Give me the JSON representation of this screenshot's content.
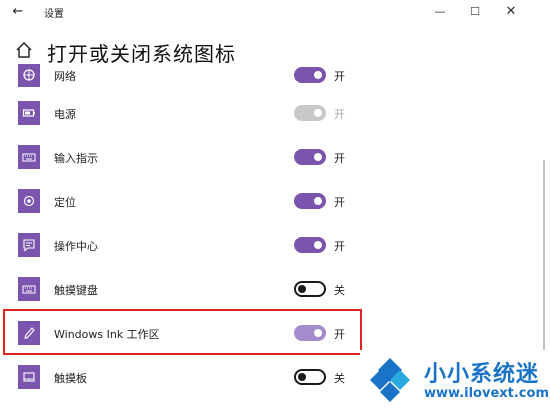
{
  "window": {
    "back_glyph": "←",
    "title": "设置",
    "min_glyph": "—",
    "max_glyph": "☐",
    "close_glyph": "✕"
  },
  "header": {
    "title": "打开或关闭系统图标"
  },
  "colors": {
    "accent": "#7a54ad",
    "accent_light": "#a48bcc",
    "disabled": "#c8c8c8",
    "highlight": "#e02424",
    "logo_blue": "#1a73c8"
  },
  "items": [
    {
      "label": "网络",
      "icon": "network-icon",
      "state": "开",
      "toggle": "on"
    },
    {
      "label": "电源",
      "icon": "battery-icon",
      "state": "开",
      "toggle": "disabled"
    },
    {
      "label": "输入指示",
      "icon": "keyboard-icon",
      "state": "开",
      "toggle": "on"
    },
    {
      "label": "定位",
      "icon": "location-icon",
      "state": "开",
      "toggle": "on"
    },
    {
      "label": "操作中心",
      "icon": "action-center-icon",
      "state": "开",
      "toggle": "on"
    },
    {
      "label": "触摸键盘",
      "icon": "touch-keyboard-icon",
      "state": "关",
      "toggle": "off"
    },
    {
      "label": "Windows Ink 工作区",
      "icon": "pen-icon",
      "state": "开",
      "toggle": "light"
    },
    {
      "label": "触摸板",
      "icon": "touchpad-icon",
      "state": "关",
      "toggle": "off"
    }
  ],
  "watermark": {
    "text": "小小系统迷",
    "url": "www.ilovext.com"
  }
}
